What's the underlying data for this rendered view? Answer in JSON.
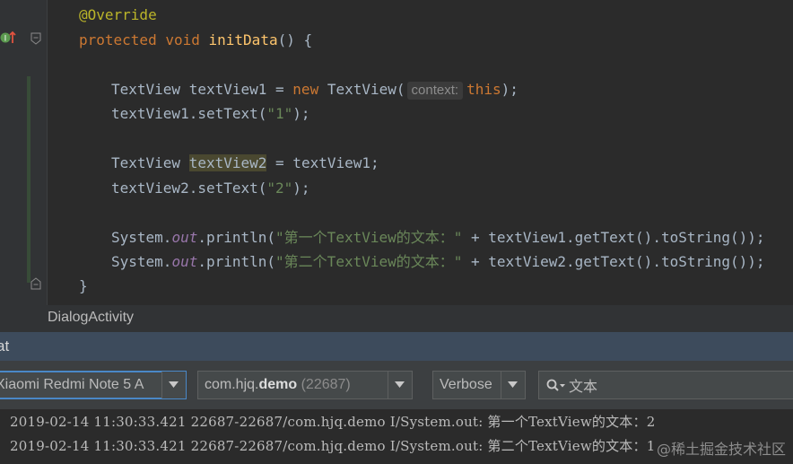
{
  "editor": {
    "lines": {
      "l1": {
        "annotation": "@Override"
      },
      "l2": {
        "kw_protected": "protected",
        "kw_void": "void",
        "method": "initData",
        "rest": "() {"
      },
      "l3": {
        "type": "TextView",
        "var": " textView1 = ",
        "kw_new": "new",
        "ctor": " TextView(",
        "hint": "context:",
        "kw_this": "this",
        "end": ");"
      },
      "l4": {
        "call": "textView1.setText(",
        "str": "\"1\"",
        "end": ");"
      },
      "l5": {
        "type": "TextView ",
        "var_hl": "textView2",
        "rest": " = textView1;"
      },
      "l6": {
        "call": "textView2.setText(",
        "str": "\"2\"",
        "end": ");"
      },
      "l7": {
        "sys": "System.",
        "out": "out",
        "call": ".println(",
        "str": "\"第一个TextView的文本：\"",
        "rest": " + textView1.getText().toString());"
      },
      "l8": {
        "sys": "System.",
        "out": "out",
        "call": ".println(",
        "str": "\"第二个TextView的文本：\"",
        "rest": " + textView2.getText().toString());"
      },
      "l9": {
        "brace": "}"
      }
    }
  },
  "breadcrumb": {
    "label": "DialogActivity"
  },
  "logcat": {
    "title": "at",
    "device": "Xiaomi Redmi Note 5 A",
    "process_prefix": "com.hjq.",
    "process_bold": "demo",
    "process_pid": "(22687)",
    "level": "Verbose",
    "search_value": "文本",
    "entries": [
      "2019-02-14 11:30:33.421 22687-22687/com.hjq.demo I/System.out: 第一个TextView的文本：2",
      "2019-02-14 11:30:33.421 22687-22687/com.hjq.demo I/System.out: 第二个TextView的文本：1"
    ]
  },
  "watermark": "@稀土掘金技术社区",
  "colors": {
    "editor_bg": "#2b2b2b",
    "keyword": "#cc7832",
    "string": "#6a8759",
    "method": "#ffc66d",
    "annotation": "#bbb529",
    "panel_header": "#3d4b5c",
    "focus_border": "#4a88c7"
  },
  "icons": [
    "override-method-icon",
    "fold-icon",
    "chevron-down-icon",
    "search-icon"
  ]
}
